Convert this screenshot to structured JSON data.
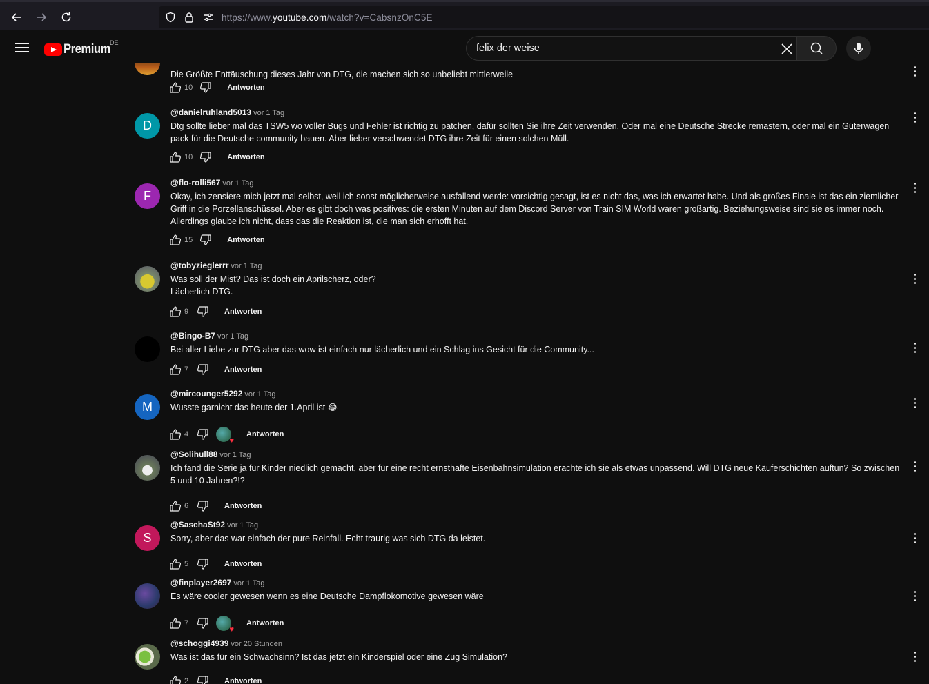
{
  "browser": {
    "url_prefix": "https://www.",
    "url_domain": "youtube.com",
    "url_path": "/watch?v=CabsnzOnC5E"
  },
  "header": {
    "logo_text": "Premium",
    "country": "DE",
    "search_value": "felix der weise"
  },
  "comments": [
    {
      "author": "",
      "time": "",
      "text": "Die Größte Enttäuschung dieses Jahr von DTG, die machen sich so unbeliebt mittlerweile",
      "likes": "10",
      "reply": "Antworten"
    },
    {
      "author": "@danielruhland5013",
      "time": "vor 1 Tag",
      "avatar_letter": "D",
      "text": "Dtg sollte lieber mal das TSW5 wo voller Bugs und Fehler ist richtig zu patchen, dafür sollten Sie ihre Zeit verwenden. Oder mal eine Deutsche Strecke remastern, oder mal ein Güterwagen pack für die Deutsche community bauen. Aber lieber verschwendet DTG ihre Zeit für einen solchen Müll.",
      "likes": "10",
      "reply": "Antworten"
    },
    {
      "author": "@flo-rolli567",
      "time": "vor 1 Tag",
      "avatar_letter": "F",
      "text": "Okay, ich zensiere mich jetzt mal selbst, weil ich sonst möglicherweise ausfallend werde: vorsichtig gesagt, ist es nicht das, was ich erwartet habe. Und als großes Finale ist das ein ziemlicher Griff in die Porzellanschüssel. Aber es gibt doch was positives: die ersten Minuten auf dem Discord Server von Train SIM  World waren großartig. Beziehungsweise sind sie es immer noch. Allerdings glaube ich nicht, dass das die Reaktion ist, die man sich erhofft hat.",
      "likes": "15",
      "reply": "Antworten"
    },
    {
      "author": "@tobyzieglerrr",
      "time": "vor 1 Tag",
      "text_lines": [
        "Was soll der Mist? Das ist doch ein Aprilscherz, oder?",
        "Lächerlich DTG."
      ],
      "likes": "9",
      "reply": "Antworten"
    },
    {
      "author": "@Bingo-B7",
      "time": "vor 1 Tag",
      "text": "Bei aller Liebe zur DTG aber das wow ist einfach nur lächerlich und ein Schlag ins Gesicht für die Community...",
      "likes": "7",
      "reply": "Antworten"
    },
    {
      "author": "@mircounger5292",
      "time": "vor 1 Tag",
      "avatar_letter": "M",
      "text": "Wusste garnicht das heute der 1.April ist 😂",
      "likes": "4",
      "reply": "Antworten"
    },
    {
      "author": "@Solihull88",
      "time": "vor 1 Tag",
      "text": "Ich fand die Serie ja für Kinder niedlich gemacht, aber für eine recht ernsthafte Eisenbahnsimulation erachte ich sie als etwas unpassend. Will DTG neue Käuferschichten auftun? So zwischen 5 und 10 Jahren?!?",
      "likes": "6",
      "reply": "Antworten"
    },
    {
      "author": "@SaschaSt92",
      "time": "vor 1 Tag",
      "avatar_letter": "S",
      "text": "Sorry, aber das war einfach der pure Reinfall. Echt traurig was sich DTG da leistet.",
      "likes": "5",
      "reply": "Antworten"
    },
    {
      "author": "@finplayer2697",
      "time": "vor 1 Tag",
      "text": "Es wäre cooler gewesen wenn es eine Deutsche Dampflokomotive gewesen wäre",
      "likes": "7",
      "reply": "Antworten"
    },
    {
      "author": "@schoggi4939",
      "time": "vor 20 Stunden",
      "text": "Was ist das für ein Schwachsinn? Ist das jetzt ein Kinderspiel oder eine Zug Simulation?",
      "likes": "2",
      "reply": "Antworten"
    }
  ],
  "colors": {
    "avatar_d": "#0097a7",
    "avatar_f": "#9c27b0",
    "avatar_m": "#1565c0",
    "avatar_s": "#c2185b"
  }
}
